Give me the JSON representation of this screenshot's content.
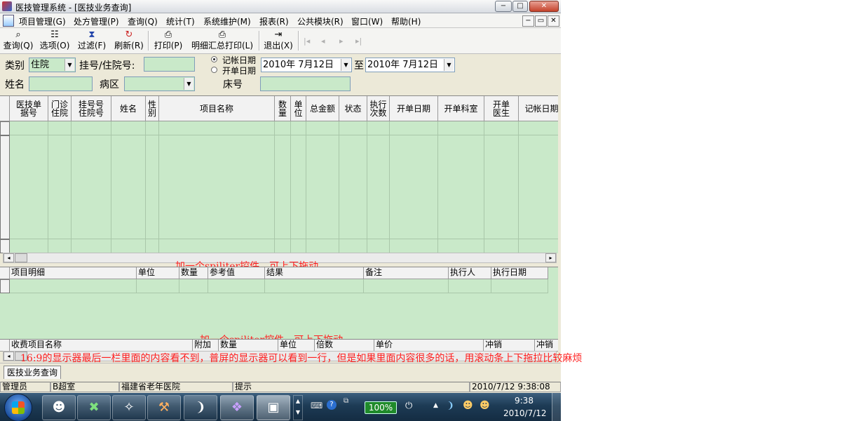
{
  "window": {
    "title": "医技管理系统 - [医技业务查询]",
    "min": "−",
    "max": "□",
    "close": "✕"
  },
  "menu": {
    "items": [
      "项目管理(G)",
      "处方管理(P)",
      "查询(Q)",
      "统计(T)",
      "系统维护(M)",
      "报表(R)",
      "公共模块(R)",
      "窗口(W)",
      "帮助(H)"
    ],
    "mdi_min": "−",
    "mdi_restore": "▭",
    "mdi_close": "✕"
  },
  "toolbar": {
    "query": "查询(Q)",
    "options": "选项(O)",
    "filter": "过滤(F)",
    "refresh": "刷新(R)",
    "print": "打印(P)",
    "detail_print": "明细汇总打印(L)",
    "exit": "退出(X)"
  },
  "filters": {
    "category_label": "类别",
    "category_value": "住院",
    "regno_label": "挂号/住院号:",
    "regno_value": "",
    "radio_post": "记帐日期",
    "radio_open": "开单日期",
    "date_from": "2010年 7月12日",
    "to_label": "至",
    "date_to": "2010年 7月12日",
    "name_label": "姓名",
    "name_value": "",
    "ward_label": "病区",
    "ward_value": "",
    "bed_label": "床号",
    "bed_value": ""
  },
  "main_grid": {
    "headers": [
      "医技单\n据号",
      "门诊\n住院",
      "挂号号\n住院号",
      "姓名",
      "性\n别",
      "项目名称",
      "数\n量",
      "单\n位",
      "总金额",
      "状态",
      "执行\n次数",
      "开单日期",
      "开单科室",
      "开单\n医生",
      "记帐日期"
    ]
  },
  "detail_grid": {
    "headers": [
      "项目明细",
      "单位",
      "数量",
      "参考值",
      "结果",
      "备注",
      "执行人",
      "执行日期"
    ]
  },
  "charge_grid": {
    "headers": [
      "收费项目名称",
      "附加",
      "数量",
      "单位",
      "倍数",
      "单价",
      "冲销",
      "冲销"
    ]
  },
  "notes": {
    "splitter1": "加一个spiliter控件，可上下拖动",
    "splitter2": "加一个spiliter控件，可上下拖动",
    "widescreen": "16:9的显示器最后一栏里面的内容看不到，普屏的显示器可以看到一行，但是如果里面内容很多的话，用滚动条上下拖拉比较麻烦"
  },
  "tab": {
    "label": "医技业务查询"
  },
  "status": {
    "user": "管理员",
    "dept": "B超室",
    "hospital": "福建省老年医院",
    "hint": "提示",
    "datetime": "2010/7/12 9:38:08"
  },
  "taskbar": {
    "battery": "100%",
    "time": "9:38",
    "date": "2010/7/12"
  }
}
